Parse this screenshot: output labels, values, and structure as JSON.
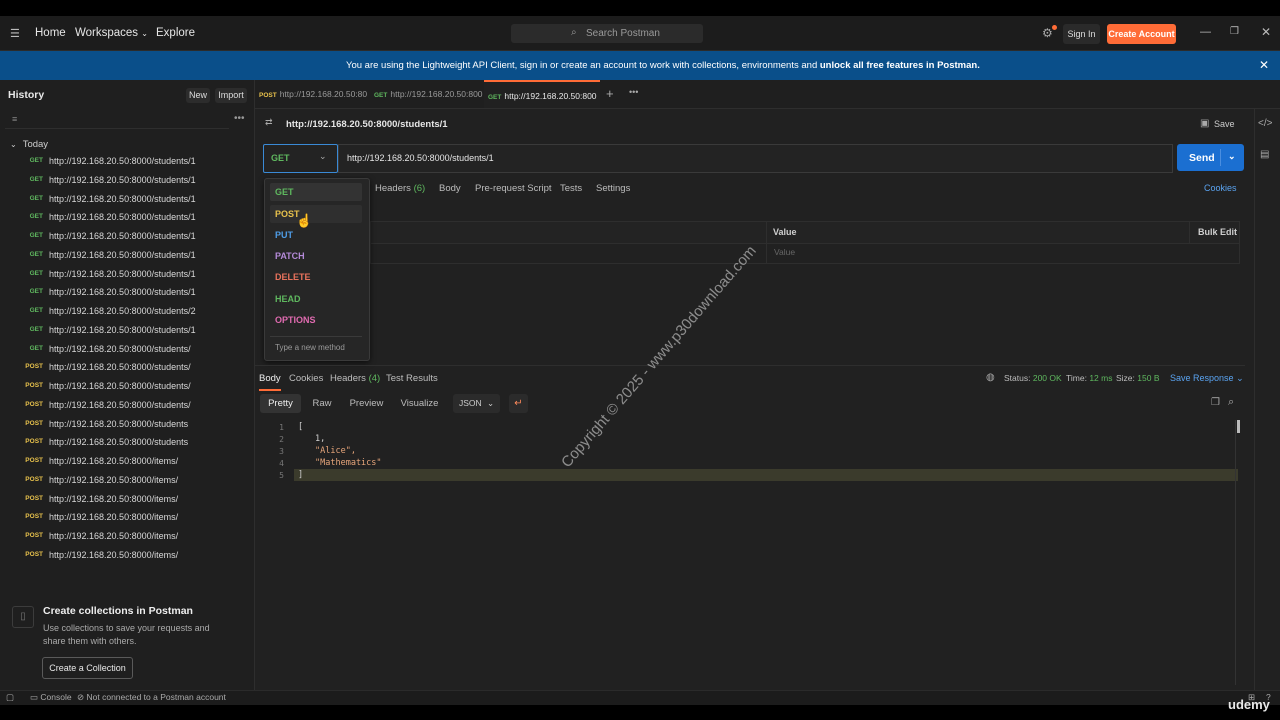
{
  "topbar": {
    "nav": [
      "Home",
      "Workspaces",
      "Explore"
    ],
    "search_placeholder": "Search Postman",
    "sign_in": "Sign In",
    "create_account": "Create Account"
  },
  "banner": {
    "message": "You are using the Lightweight API Client, sign in or create an account to work with collections, environments and ",
    "bold": "unlock all free features in Postman."
  },
  "sidebar": {
    "title": "History",
    "new_label": "New",
    "import_label": "Import",
    "group": "Today",
    "items": [
      {
        "method": "GET",
        "url": "http://192.168.20.50:8000/students/1"
      },
      {
        "method": "GET",
        "url": "http://192.168.20.50:8000/students/1"
      },
      {
        "method": "GET",
        "url": "http://192.168.20.50:8000/students/1"
      },
      {
        "method": "GET",
        "url": "http://192.168.20.50:8000/students/1"
      },
      {
        "method": "GET",
        "url": "http://192.168.20.50:8000/students/1"
      },
      {
        "method": "GET",
        "url": "http://192.168.20.50:8000/students/1"
      },
      {
        "method": "GET",
        "url": "http://192.168.20.50:8000/students/1"
      },
      {
        "method": "GET",
        "url": "http://192.168.20.50:8000/students/1"
      },
      {
        "method": "GET",
        "url": "http://192.168.20.50:8000/students/2"
      },
      {
        "method": "GET",
        "url": "http://192.168.20.50:8000/students/1"
      },
      {
        "method": "GET",
        "url": "http://192.168.20.50:8000/students/"
      },
      {
        "method": "POST",
        "url": "http://192.168.20.50:8000/students/"
      },
      {
        "method": "POST",
        "url": "http://192.168.20.50:8000/students/"
      },
      {
        "method": "POST",
        "url": "http://192.168.20.50:8000/students/"
      },
      {
        "method": "POST",
        "url": "http://192.168.20.50:8000/students"
      },
      {
        "method": "POST",
        "url": "http://192.168.20.50:8000/students"
      },
      {
        "method": "POST",
        "url": "http://192.168.20.50:8000/items/"
      },
      {
        "method": "POST",
        "url": "http://192.168.20.50:8000/items/"
      },
      {
        "method": "POST",
        "url": "http://192.168.20.50:8000/items/"
      },
      {
        "method": "POST",
        "url": "http://192.168.20.50:8000/items/"
      },
      {
        "method": "POST",
        "url": "http://192.168.20.50:8000/items/"
      },
      {
        "method": "POST",
        "url": "http://192.168.20.50:8000/items/"
      }
    ],
    "promo": {
      "title": "Create collections in Postman",
      "text": "Use collections to save your requests and share them with others.",
      "button": "Create a Collection"
    }
  },
  "tabs": [
    {
      "method": "POST",
      "url": "http://192.168.20.50:80"
    },
    {
      "method": "GET",
      "url": "http://192.168.20.50:800"
    },
    {
      "method": "GET",
      "url": "http://192.168.20.50:800"
    }
  ],
  "request": {
    "title": "http://192.168.20.50:8000/students/1",
    "save": "Save",
    "method": "GET",
    "url": "http://192.168.20.50:8000/students/1",
    "send": "Send",
    "subtabs": {
      "headers": "Headers",
      "headers_count": "(6)",
      "body": "Body",
      "prerequest": "Pre-request Script",
      "tests": "Tests",
      "settings": "Settings"
    },
    "cookies": "Cookies",
    "params": {
      "value_header": "Value",
      "bulk_edit": "Bulk Edit",
      "value_placeholder": "Value"
    }
  },
  "method_dropdown": {
    "items": [
      {
        "label": "GET",
        "color": "#5fb85f"
      },
      {
        "label": "POST",
        "color": "#e8c24c"
      },
      {
        "label": "PUT",
        "color": "#4f9ee8"
      },
      {
        "label": "PATCH",
        "color": "#b48ad8"
      },
      {
        "label": "DELETE",
        "color": "#e8725c"
      },
      {
        "label": "HEAD",
        "color": "#5fb85f"
      },
      {
        "label": "OPTIONS",
        "color": "#e06bb0"
      }
    ],
    "new_method": "Type a new method"
  },
  "response": {
    "tabs": {
      "body": "Body",
      "cookies": "Cookies",
      "headers": "Headers",
      "headers_count": "(4)",
      "test_results": "Test Results"
    },
    "status_label": "Status:",
    "status_value": "200 OK",
    "time_label": "Time:",
    "time_value": "12 ms",
    "size_label": "Size:",
    "size_value": "150 B",
    "save_response": "Save Response",
    "formats": [
      "Pretty",
      "Raw",
      "Preview",
      "Visualize"
    ],
    "format_type": "JSON",
    "lines": [
      {
        "n": "1",
        "text": "[",
        "kind": "br"
      },
      {
        "n": "2",
        "text": "1,",
        "kind": "num"
      },
      {
        "n": "3",
        "text": "\"Alice\",",
        "kind": "str"
      },
      {
        "n": "4",
        "text": "\"Mathematics\"",
        "kind": "str"
      },
      {
        "n": "5",
        "text": "]",
        "kind": "br"
      }
    ]
  },
  "statusbar": {
    "console": "Console",
    "connection": "Not connected to a Postman account"
  },
  "watermark": "Copyright © 2025 - www.p30download.com",
  "udemy": "udemy"
}
